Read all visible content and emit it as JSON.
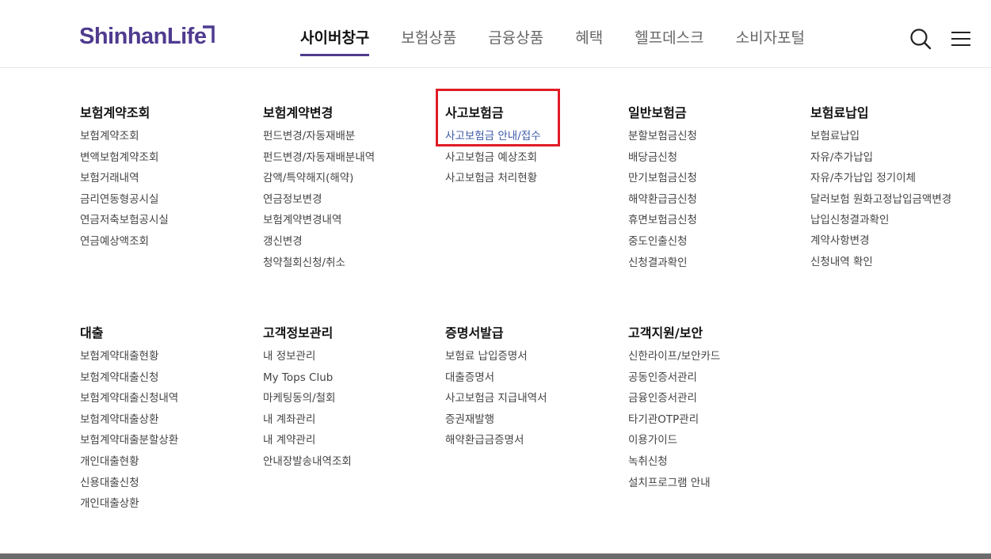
{
  "header": {
    "logo": "ShinhanLife",
    "nav": [
      "사이버창구",
      "보험상품",
      "금융상품",
      "혜택",
      "헬프데스크",
      "소비자포털"
    ]
  },
  "menu": {
    "row1": [
      {
        "title": "보험계약조회",
        "items": [
          "보험계약조회",
          "변액보험계약조회",
          "보험거래내역",
          "금리연동형공시실",
          "연금저축보험공시실",
          "연금예상액조회"
        ]
      },
      {
        "title": "보험계약변경",
        "items": [
          "펀드변경/자동재배분",
          "펀드변경/자동재배분내역",
          "감액/특약해지(해약)",
          "연금정보변경",
          "보험계약변경내역",
          "갱신변경",
          "청약철회신청/취소"
        ]
      },
      {
        "title": "사고보험금",
        "items": [
          "사고보험금 안내/접수",
          "사고보험금 예상조회",
          "사고보험금 처리현황"
        ]
      },
      {
        "title": "일반보험금",
        "items": [
          "분할보험금신청",
          "배당금신청",
          "만기보험금신청",
          "해약환급금신청",
          "휴면보험금신청",
          "중도인출신청",
          "신청결과확인"
        ]
      },
      {
        "title": "보험료납입",
        "items": [
          "보험료납입",
          "자유/추가납입",
          "자유/추가납입 정기이체",
          "달러보험 원화고정납입금액변경",
          "납입신청결과확인",
          "계약사항변경",
          "신청내역 확인"
        ]
      }
    ],
    "row2": [
      {
        "title": "대출",
        "items": [
          "보험계약대출현황",
          "보험계약대출신청",
          "보험계약대출신청내역",
          "보험계약대출상환",
          "보험계약대출분할상환",
          "개인대출현황",
          "신용대출신청",
          "개인대출상환"
        ]
      },
      {
        "title": "고객정보관리",
        "items": [
          "내 정보관리",
          "My Tops Club",
          "마케팅동의/철회",
          "내 계좌관리",
          "내 계약관리",
          "안내장발송내역조회"
        ]
      },
      {
        "title": "증명서발급",
        "items": [
          "보험료 납입증명서",
          "대출증명서",
          "사고보험금 지급내역서",
          "증권재발행",
          "해약환급금증명서"
        ]
      },
      {
        "title": "고객지원/보안",
        "items": [
          "신한라이프/보안카드",
          "공동인증서관리",
          "금융인증서관리",
          "타기관OTP관리",
          "이용가이드",
          "녹취신청",
          "설치프로그램 안내"
        ]
      }
    ]
  },
  "colors": {
    "brand": "#4f3b8f",
    "highlight": "#e01c26",
    "link_hover": "#3d5aa8"
  }
}
